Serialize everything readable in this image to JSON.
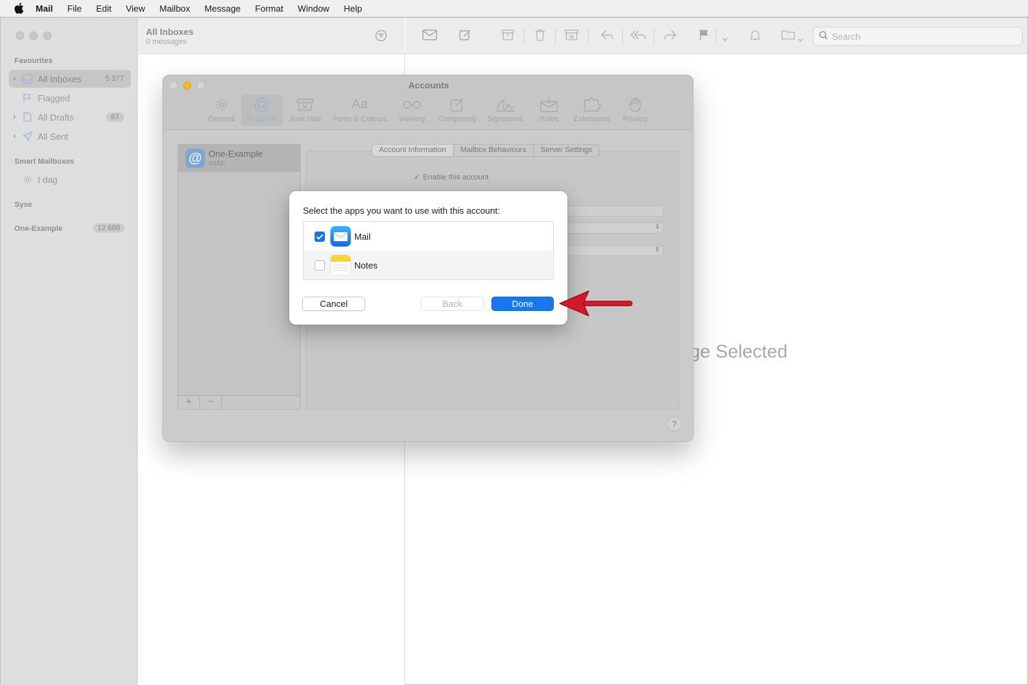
{
  "menubar": {
    "items": [
      "Mail",
      "File",
      "Edit",
      "View",
      "Mailbox",
      "Message",
      "Format",
      "Window",
      "Help"
    ]
  },
  "sidebar": {
    "favourites_label": "Favourites",
    "items": [
      {
        "label": "All Inboxes",
        "count": "5 377",
        "icon": "inbox-icon"
      },
      {
        "label": "Flagged",
        "count": "",
        "icon": "flag-icon"
      },
      {
        "label": "All Drafts",
        "count": "67",
        "icon": "draft-icon"
      },
      {
        "label": "All Sent",
        "count": "",
        "icon": "sent-icon"
      }
    ],
    "smart_label": "Smart Mailboxes",
    "smart_items": [
      {
        "label": "I dag",
        "icon": "gear-icon"
      }
    ],
    "syse_label": "Syse",
    "account_label": "One-Example",
    "account_count": "12 686"
  },
  "message_list": {
    "title": "All Inboxes",
    "subtitle": "0 messages"
  },
  "toolbar": {
    "search_placeholder": "Search"
  },
  "viewer": {
    "empty_text": "No Message Selected"
  },
  "prefs": {
    "title": "Accounts",
    "tabs": [
      "General",
      "Accounts",
      "Junk Mail",
      "Fonts & Colours",
      "Viewing",
      "Composing",
      "Signatures",
      "Rules",
      "Extensions",
      "Privacy"
    ],
    "account_name": "One-Example",
    "account_type": "IMAP",
    "segments": [
      "Account Information",
      "Mailbox Behaviours",
      "Server Settings"
    ],
    "enable_label": "Enable this account",
    "help_label": "?",
    "add_label": "+",
    "remove_label": "−"
  },
  "sheet": {
    "prompt": "Select the apps you want to use with this account:",
    "apps": [
      {
        "label": "Mail",
        "checked": true
      },
      {
        "label": "Notes",
        "checked": false
      }
    ],
    "cancel_label": "Cancel",
    "back_label": "Back",
    "done_label": "Done"
  },
  "colors": {
    "accent": "#1677ee",
    "annotation_arrow": "#c8102e"
  }
}
